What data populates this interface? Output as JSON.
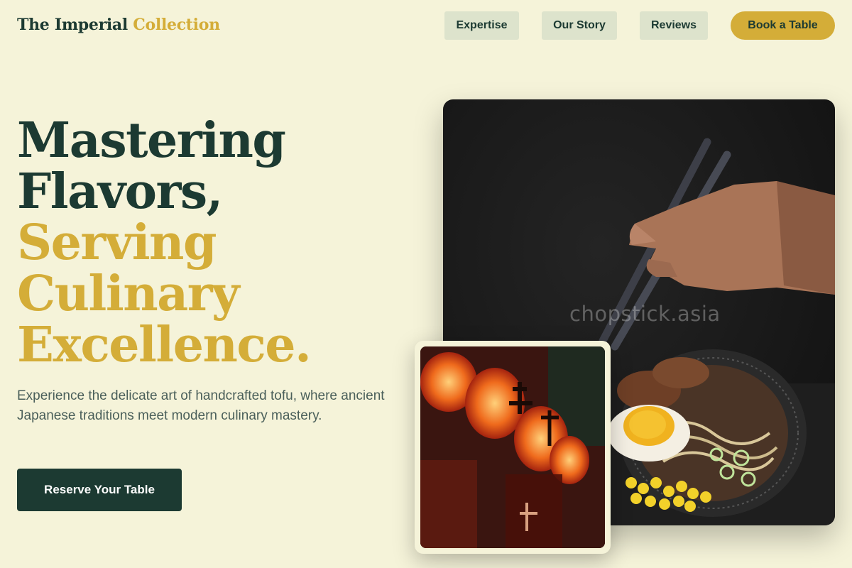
{
  "brand": {
    "name_part1": "The Imperial",
    "name_part2": "Collection"
  },
  "nav": {
    "expertise": "Expertise",
    "our_story": "Our Story",
    "reviews": "Reviews",
    "book": "Book a Table"
  },
  "hero": {
    "line1": "Mastering",
    "line2": "Flavors,",
    "line3": "Serving",
    "line4": "Culinary",
    "line5": "Excellence.",
    "description": "Experience the delicate art of handcrafted tofu, where ancient Japanese traditions meet modern culinary mastery.",
    "cta": "Reserve Your Table"
  },
  "images": {
    "main_watermark": "chopstick.asia"
  },
  "colors": {
    "background": "#f5f3d9",
    "dark_green": "#1c3a32",
    "gold": "#d4ad38",
    "nav_button": "#dde3cc"
  }
}
